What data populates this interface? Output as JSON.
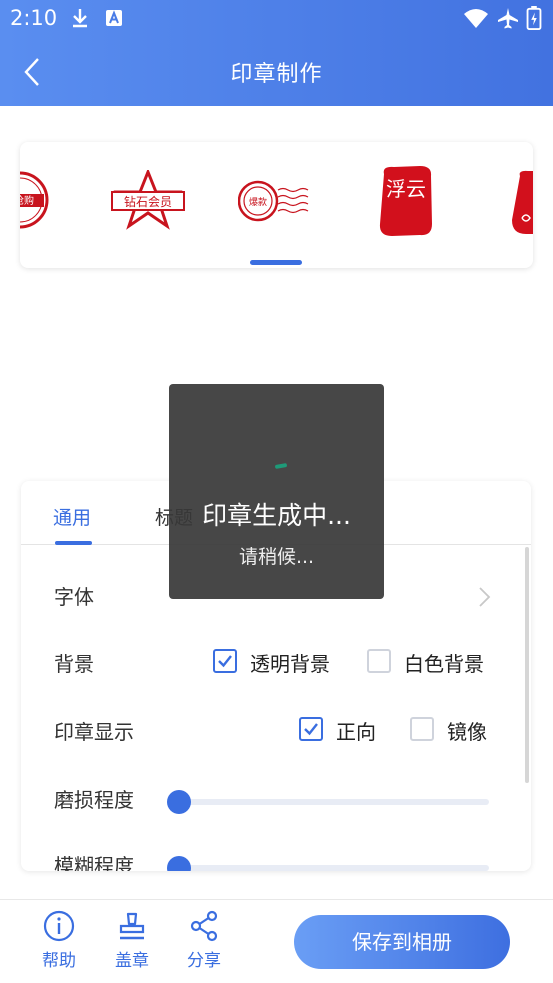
{
  "status_bar": {
    "time": "2:10",
    "icons": [
      "download-icon",
      "text-a-icon",
      "wifi-icon",
      "airplane-icon",
      "battery-charging-icon"
    ]
  },
  "header": {
    "title": "印章制作",
    "back_icon": "chevron-left-icon",
    "color_start": "#5a8ef0",
    "color_end": "#4272e0"
  },
  "stamp_templates": {
    "items": [
      {
        "text": "抢购"
      },
      {
        "text": "钻石会员"
      },
      {
        "text": "爆款"
      },
      {
        "text": "浮云"
      },
      {
        "text": ""
      }
    ],
    "stamp_color": "#c8141e"
  },
  "panel": {
    "tabs": [
      {
        "label": "通用",
        "active": true
      },
      {
        "label": "标题",
        "active": false
      }
    ],
    "font_row": {
      "label": "字体"
    },
    "background_row": {
      "label": "背景",
      "options": [
        {
          "label": "透明背景",
          "checked": true
        },
        {
          "label": "白色背景",
          "checked": false
        }
      ]
    },
    "display_row": {
      "label": "印章显示",
      "options": [
        {
          "label": "正向",
          "checked": true
        },
        {
          "label": "镜像",
          "checked": false
        }
      ]
    },
    "wear_row": {
      "label": "磨损程度",
      "value": 0
    },
    "blur_row": {
      "label": "模糊程度",
      "value": 0
    }
  },
  "toast": {
    "title": "印章生成中...",
    "subtitle": "请稍候..."
  },
  "bottom_bar": {
    "items": [
      {
        "label": "帮助",
        "icon": "info-icon"
      },
      {
        "label": "盖章",
        "icon": "stamp-icon"
      },
      {
        "label": "分享",
        "icon": "share-icon"
      }
    ],
    "save_label": "保存到相册",
    "accent": "#3a6ee0"
  }
}
